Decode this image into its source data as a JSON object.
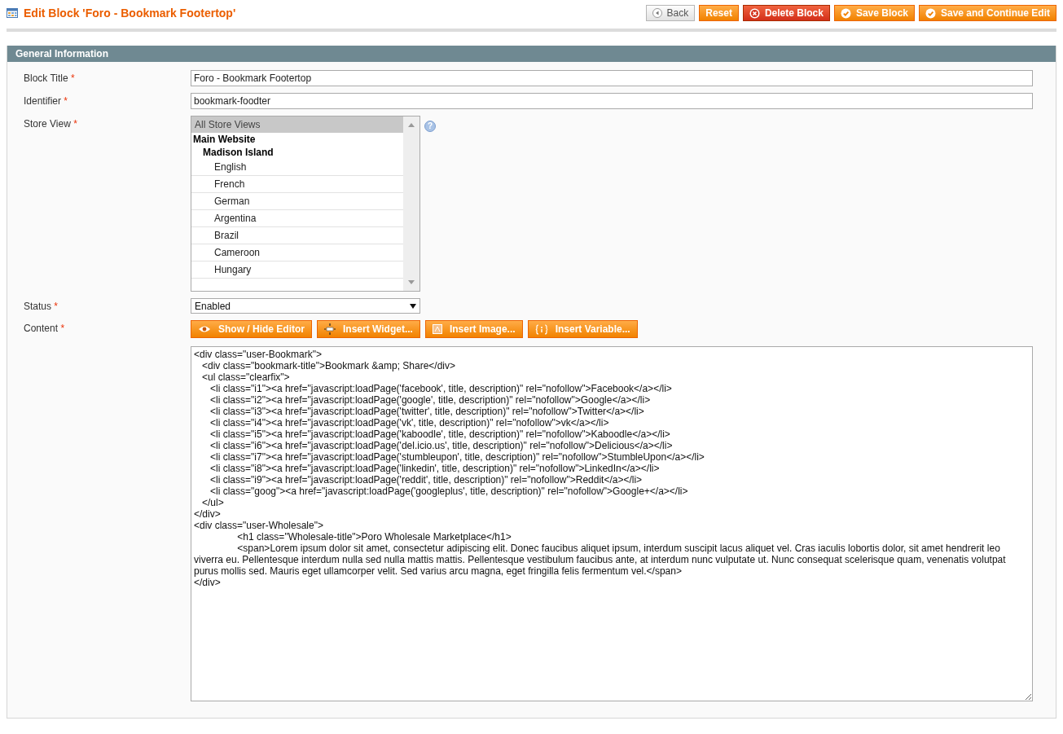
{
  "page_title": "Edit Block 'Foro - Bookmark Footertop'",
  "actions": [
    {
      "kind": "back",
      "label": "Back"
    },
    {
      "kind": "reset",
      "label": "Reset"
    },
    {
      "kind": "delete",
      "label": "Delete Block"
    },
    {
      "kind": "save",
      "label": "Save Block"
    },
    {
      "kind": "save",
      "label": "Save and Continue Edit"
    }
  ],
  "section": {
    "title": "General Information"
  },
  "fields": {
    "block_title": {
      "label": "Block Title",
      "required_mark": "*",
      "value": "Foro - Bookmark Footertop"
    },
    "identifier": {
      "label": "Identifier",
      "required_mark": "*",
      "value": "bookmark-foodter"
    },
    "store_view": {
      "label": "Store View",
      "required_mark": "*",
      "help": "?",
      "options": [
        {
          "label": "All Store Views",
          "selected": true
        },
        {
          "group": "Main Website",
          "children": [
            {
              "group": "Madison Island",
              "children": [
                {
                  "label": "English",
                  "selected": false
                },
                {
                  "label": "French",
                  "selected": false
                },
                {
                  "label": "German",
                  "selected": false
                },
                {
                  "label": "Argentina",
                  "selected": false
                },
                {
                  "label": "Brazil",
                  "selected": false
                },
                {
                  "label": "Cameroon",
                  "selected": false
                },
                {
                  "label": "Hungary",
                  "selected": false
                }
              ]
            }
          ]
        }
      ]
    },
    "status": {
      "label": "Status",
      "required_mark": "*",
      "value": "Enabled"
    },
    "content": {
      "label": "Content",
      "required_mark": "*",
      "editor_buttons": [
        {
          "kind": "eye",
          "label": "Show / Hide Editor"
        },
        {
          "kind": "widget",
          "label": "Insert Widget..."
        },
        {
          "kind": "image",
          "label": "Insert Image..."
        },
        {
          "kind": "variable",
          "label": "Insert Variable..."
        }
      ],
      "value": "<div class=\"user-Bookmark\">\n   <div class=\"bookmark-title\">Bookmark &amp; Share</div>\n   <ul class=\"clearfix\">\n      <li class=\"i1\"><a href=\"javascript:loadPage('facebook', title, description)\" rel=\"nofollow\">Facebook</a></li>\n      <li class=\"i2\"><a href=\"javascript:loadPage('google', title, description)\" rel=\"nofollow\">Google</a></li>\n      <li class=\"i3\"><a href=\"javascript:loadPage('twitter', title, description)\" rel=\"nofollow\">Twitter</a></li>\n      <li class=\"i4\"><a href=\"javascript:loadPage('vk', title, description)\" rel=\"nofollow\">vk</a></li>\n      <li class=\"i5\"><a href=\"javascript:loadPage('kaboodle', title, description)\" rel=\"nofollow\">Kaboodle</a></li>\n      <li class=\"i6\"><a href=\"javascript:loadPage('del.icio.us', title, description)\" rel=\"nofollow\">Delicious</a></li>\n      <li class=\"i7\"><a href=\"javascript:loadPage('stumbleupon', title, description)\" rel=\"nofollow\">StumbleUpon</a></li>\n      <li class=\"i8\"><a href=\"javascript:loadPage('linkedin', title, description)\" rel=\"nofollow\">LinkedIn</a></li>\n      <li class=\"i9\"><a href=\"javascript:loadPage('reddit', title, description)\" rel=\"nofollow\">Reddit</a></li>\n      <li class=\"goog\"><a href=\"javascript:loadPage('googleplus', title, description)\" rel=\"nofollow\">Google+</a></li>\n   </ul>\n</div>\n<div class=\"user-Wholesale\">\n\t\t<h1 class=\"Wholesale-title\">Poro Wholesale Marketplace</h1>\n\t\t<span>Lorem ipsum dolor sit amet, consectetur adipiscing elit. Donec faucibus aliquet ipsum, interdum suscipit lacus aliquet vel. Cras iaculis lobortis dolor, sit amet hendrerit leo viverra eu. Pellentesque interdum nulla sed nulla mattis mattis. Pellentesque vestibulum faucibus ante, at interdum nunc vulputate ut. Nunc consequat scelerisque quam, venenatis volutpat purus mollis sed. Mauris eget ullamcorper velit. Sed varius arcu magna, eget fringilla felis fermentum vel.</span>\n</div>"
    }
  }
}
